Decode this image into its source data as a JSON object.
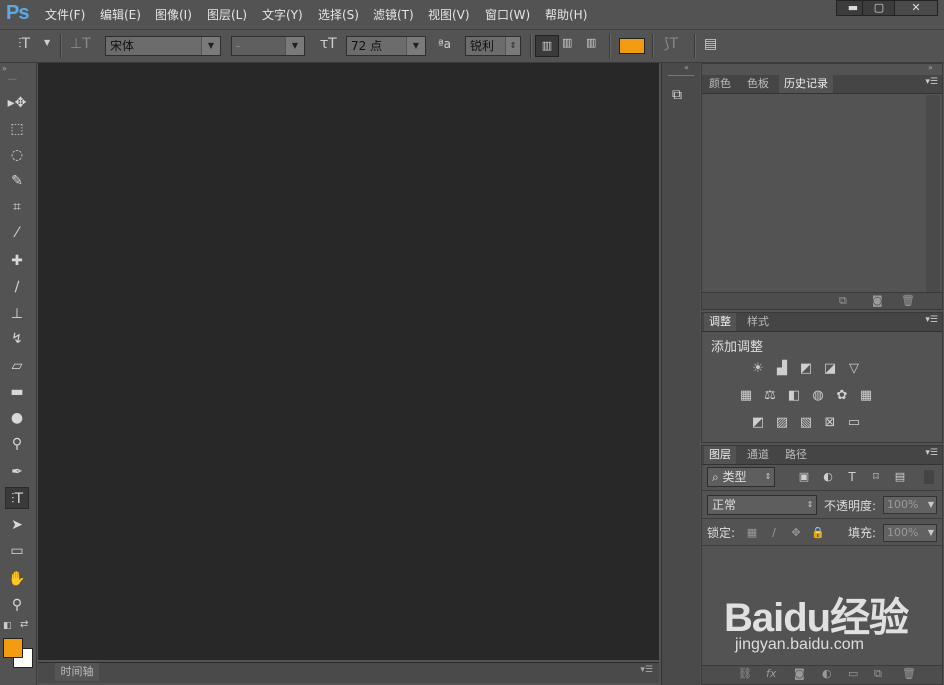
{
  "app": {
    "logo": "Ps",
    "accent": "#5fa8e8"
  },
  "menu": [
    "文件(F)",
    "编辑(E)",
    "图像(I)",
    "图层(L)",
    "文字(Y)",
    "选择(S)",
    "滤镜(T)",
    "视图(V)",
    "窗口(W)",
    "帮助(H)"
  ],
  "window_controls": {
    "minimize": "▬",
    "maximize": "▢",
    "close": "✕"
  },
  "options": {
    "font_family": "宋体",
    "font_style": "-",
    "font_size": "72 点",
    "antialias": "锐利",
    "text_color": "#f39c12"
  },
  "toolbox": {
    "tools": [
      "move-tool",
      "marquee-tool",
      "lasso-tool",
      "quick-select-tool",
      "crop-tool",
      "eyedropper-tool",
      "healing-brush-tool",
      "brush-tool",
      "clone-stamp-tool",
      "history-brush-tool",
      "eraser-tool",
      "gradient-tool",
      "blur-tool",
      "dodge-tool",
      "pen-tool",
      "type-tool",
      "path-select-tool",
      "rectangle-tool",
      "hand-tool",
      "zoom-tool"
    ],
    "active_tool": "type-tool",
    "foreground_color": "#f39c12",
    "background_color": "#ffffff"
  },
  "timeline": {
    "tab": "时间轴"
  },
  "history_panel": {
    "tabs": [
      "颜色",
      "色板",
      "历史记录"
    ],
    "active_tab": "历史记录"
  },
  "adjustments_panel": {
    "tabs": [
      "调整",
      "样式"
    ],
    "active_tab": "调整",
    "title": "添加调整"
  },
  "layers_panel": {
    "tabs": [
      "图层",
      "通道",
      "路径"
    ],
    "active_tab": "图层",
    "filter_kind": "类型",
    "blend_mode": "正常",
    "opacity_label": "不透明度:",
    "opacity_value": "100%",
    "lock_label": "锁定:",
    "fill_label": "填充:",
    "fill_value": "100%"
  },
  "watermark": {
    "brand": "Baidu经验",
    "url": "jingyan.baidu.com"
  }
}
